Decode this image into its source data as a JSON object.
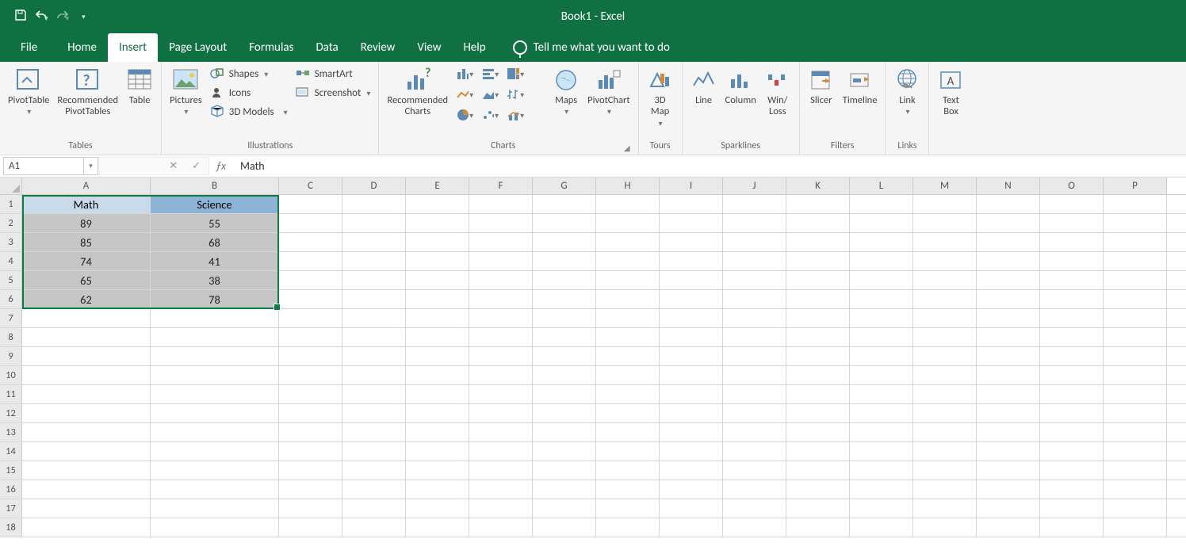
{
  "app": {
    "title": "Book1  -  Excel"
  },
  "tabs": {
    "file": "File",
    "home": "Home",
    "insert": "Insert",
    "page_layout": "Page Layout",
    "formulas": "Formulas",
    "data": "Data",
    "review": "Review",
    "view": "View",
    "help": "Help",
    "tell_me": "Tell me what you want to do"
  },
  "ribbon": {
    "tables": {
      "pivottable": "PivotTable",
      "recommended_pt": "Recommended\nPivotTables",
      "table": "Table",
      "label": "Tables"
    },
    "illustrations": {
      "pictures": "Pictures",
      "shapes": "Shapes",
      "icons": "Icons",
      "models": "3D Models",
      "smartart": "SmartArt",
      "screenshot": "Screenshot",
      "label": "Illustrations"
    },
    "charts": {
      "recommended": "Recommended\nCharts",
      "label": "Charts"
    },
    "maps": {
      "maps": "Maps",
      "pivotchart": "PivotChart"
    },
    "tours": {
      "map3d": "3D\nMap",
      "label": "Tours"
    },
    "sparklines": {
      "line": "Line",
      "column": "Column",
      "winloss": "Win/\nLoss",
      "label": "Sparklines"
    },
    "filters": {
      "slicer": "Slicer",
      "timeline": "Timeline",
      "label": "Filters"
    },
    "links": {
      "link": "Link",
      "label": "Links"
    },
    "text": {
      "textbox": "Text\nBox"
    }
  },
  "formula_bar": {
    "name": "A1",
    "formula": "Math"
  },
  "grid": {
    "columns": [
      "A",
      "B",
      "C",
      "D",
      "E",
      "F",
      "G",
      "H",
      "I",
      "J",
      "K",
      "L",
      "M",
      "N",
      "O",
      "P"
    ],
    "data": [
      {
        "A": "Math",
        "B": "Science"
      },
      {
        "A": "89",
        "B": "55"
      },
      {
        "A": "85",
        "B": "68"
      },
      {
        "A": "74",
        "B": "41"
      },
      {
        "A": "65",
        "B": "38"
      },
      {
        "A": "62",
        "B": "78"
      }
    ]
  },
  "chart_data": {
    "type": "table",
    "columns": [
      "Math",
      "Science"
    ],
    "rows": [
      [
        89,
        55
      ],
      [
        85,
        68
      ],
      [
        74,
        41
      ],
      [
        65,
        38
      ],
      [
        62,
        78
      ]
    ]
  }
}
